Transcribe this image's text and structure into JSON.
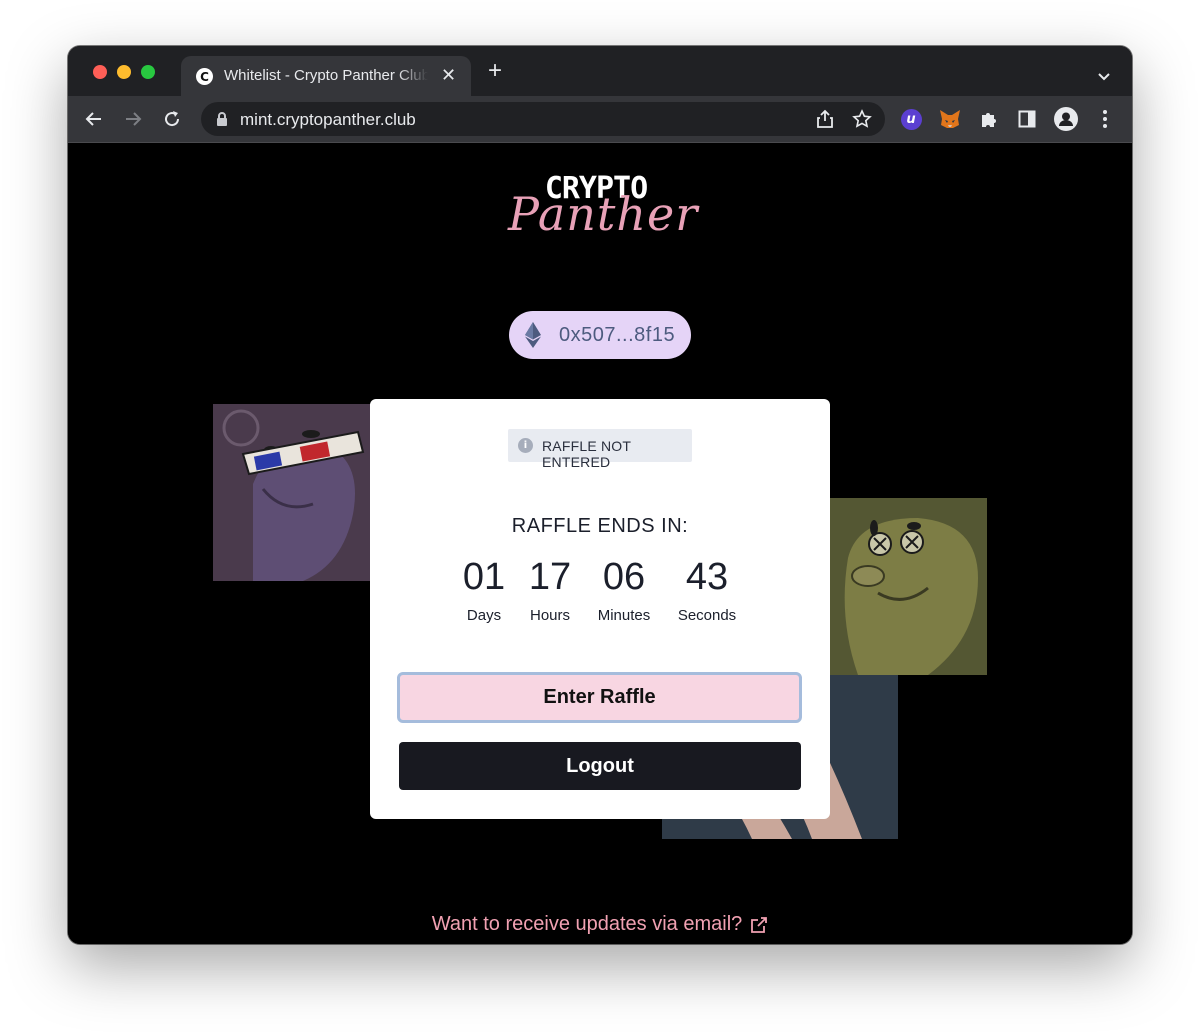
{
  "browser": {
    "tab": {
      "title": "Whitelist - Crypto Panther Club",
      "favicon_letter": "C"
    },
    "address": {
      "url": "mint.cryptopanther.club"
    },
    "extensions": {
      "u_letter": "u"
    }
  },
  "page": {
    "logo": {
      "line1": "CRYPTO",
      "line2": "Panther"
    },
    "wallet": {
      "address": "0x507...8f15",
      "icon": "ethereum-icon"
    },
    "raffle": {
      "status": "RAFFLE NOT ENTERED",
      "ends_label": "RAFFLE ENDS IN:",
      "countdown": [
        {
          "value": "01",
          "label": "Days"
        },
        {
          "value": "17",
          "label": "Hours"
        },
        {
          "value": "06",
          "label": "Minutes"
        },
        {
          "value": "43",
          "label": "Seconds"
        }
      ],
      "enter_label": "Enter Raffle",
      "logout_label": "Logout"
    },
    "email_link": "Want to receive updates via email?"
  },
  "colors": {
    "enter_bg": "#f8d6e2",
    "enter_border": "#a5bcdc",
    "logout_bg": "#181920",
    "link": "#f1a1b2",
    "wallet_bg": "#e5d4f7",
    "logo_script": "#e8a1b7"
  }
}
